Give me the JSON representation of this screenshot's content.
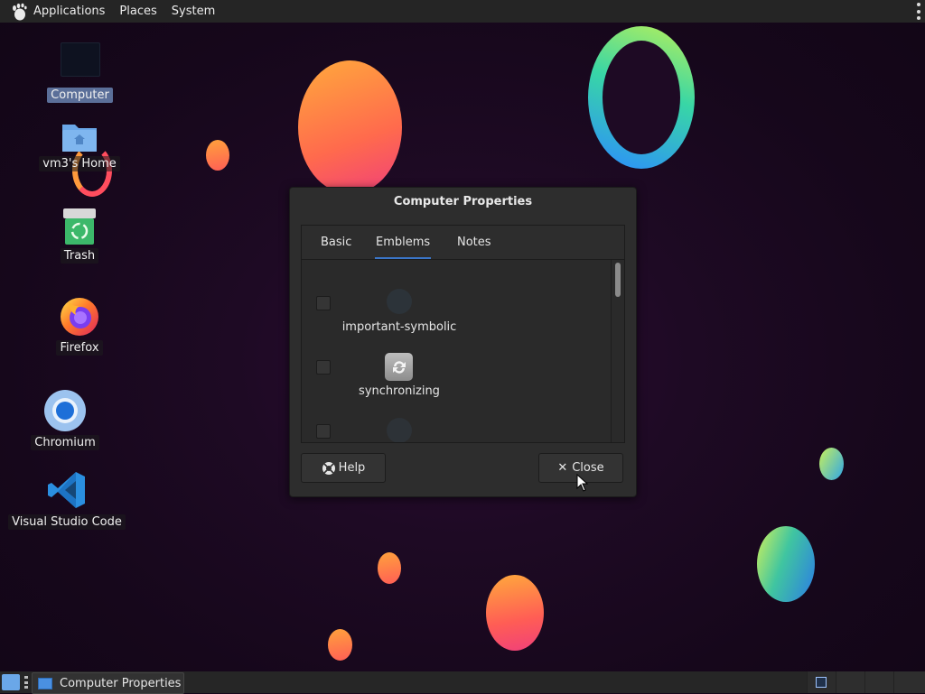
{
  "top_panel": {
    "menus": [
      "Applications",
      "Places",
      "System"
    ]
  },
  "desktop": {
    "icons": [
      {
        "label": "Computer",
        "icon": "computer-icon",
        "selected": true
      },
      {
        "label": "vm3's Home",
        "icon": "home-folder-icon"
      },
      {
        "label": "Trash",
        "icon": "trash-icon"
      },
      {
        "label": "Firefox",
        "icon": "firefox-icon"
      },
      {
        "label": "Chromium",
        "icon": "chromium-icon"
      },
      {
        "label": "Visual Studio Code",
        "icon": "vscode-icon"
      }
    ]
  },
  "dialog": {
    "title": "Computer Properties",
    "tabs": [
      {
        "label": "Basic"
      },
      {
        "label": "Emblems",
        "active": true
      },
      {
        "label": "Notes"
      }
    ],
    "emblems": [
      {
        "label": "important-symbolic",
        "checked": false
      },
      {
        "label": "synchronizing",
        "checked": false
      },
      {
        "label": "",
        "checked": false
      }
    ],
    "buttons": {
      "help_label": "Help",
      "close_label": "Close"
    }
  },
  "taskbar": {
    "task_label": "Computer Properties"
  },
  "colors": {
    "accent": "#3a75c8",
    "selected_label": "#5b6f99",
    "panel": "#252525",
    "dialog": "#2d2d2d"
  }
}
